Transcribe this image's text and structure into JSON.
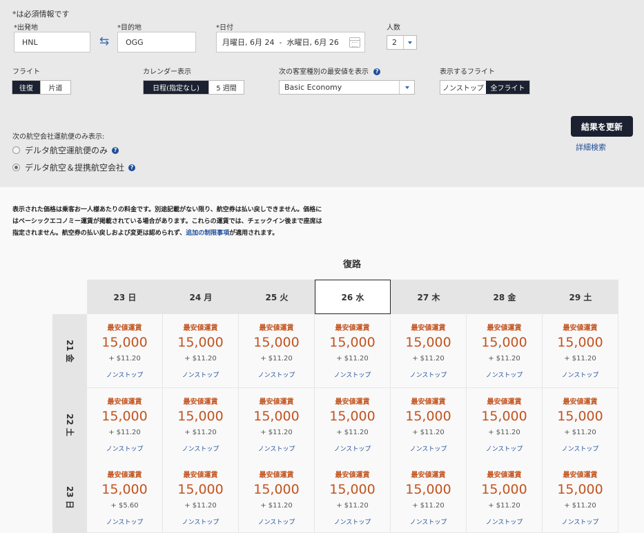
{
  "form": {
    "required_note": "*は必須情報です",
    "origin_label": "*出発地",
    "origin_value": "HNL",
    "destination_label": "*目的地",
    "destination_value": "OGG",
    "date_label": "*日付",
    "date_value": "月曜日, 6月 24  -  水曜日, 6月 26",
    "passengers_label": "人数",
    "passengers_value": "2"
  },
  "options": {
    "flight_label": "フライト",
    "flight_roundtrip": "往復",
    "flight_oneway": "片道",
    "calendar_label": "カレンダー表示",
    "calendar_flexible": "日程(指定なし)",
    "calendar_5weeks": "5 週間",
    "cabin_label": "次の客室種別の最安値を表示",
    "cabin_value": "Basic Economy",
    "display_label": "表示するフライト",
    "display_nonstop": "ノンストップ",
    "display_all": "全フライト"
  },
  "airline_filter": {
    "label": "次の航空会社運航便のみ表示:",
    "option_delta_only": "デルタ航空運航便のみ",
    "option_delta_partners": "デルタ航空＆提携航空会社"
  },
  "actions": {
    "update_label": "結果を更新",
    "advanced_search_label": "詳細検索"
  },
  "disclaimer": {
    "text": "表示された価格は乗客お一人様あたりの料金です。別途記載がない限り、航空券は払い戻しできません。価格にはベーシックエコノミー運賃が掲載されている場合があります。これらの運賃では、チェックイン後まで座席は指定されません。航空券の払い戻しおよび変更は認められず、",
    "link_text": "追加の制限事項",
    "suffix": "が適用されます。"
  },
  "grid": {
    "return_label": "復路",
    "return_days": [
      "23 日",
      "24 月",
      "25 火",
      "26 水",
      "27 木",
      "28 金",
      "29 土"
    ],
    "rows": [
      {
        "label": "21 金",
        "cells": [
          {
            "type": "最安値運賃",
            "price": "15,000",
            "tax": "+ $11.20",
            "stops": "ノンストップ"
          },
          {
            "type": "最安値運賃",
            "price": "15,000",
            "tax": "+ $11.20",
            "stops": "ノンストップ"
          },
          {
            "type": "最安値運賃",
            "price": "15,000",
            "tax": "+ $11.20",
            "stops": "ノンストップ"
          },
          {
            "type": "最安値運賃",
            "price": "15,000",
            "tax": "+ $11.20",
            "stops": "ノンストップ"
          },
          {
            "type": "最安値運賃",
            "price": "15,000",
            "tax": "+ $11.20",
            "stops": "ノンストップ"
          },
          {
            "type": "最安値運賃",
            "price": "15,000",
            "tax": "+ $11.20",
            "stops": "ノンストップ"
          },
          {
            "type": "最安値運賃",
            "price": "15,000",
            "tax": "+ $11.20",
            "stops": "ノンストップ"
          }
        ]
      },
      {
        "label": "22 土",
        "cells": [
          {
            "type": "最安値運賃",
            "price": "15,000",
            "tax": "+ $11.20",
            "stops": "ノンストップ"
          },
          {
            "type": "最安値運賃",
            "price": "15,000",
            "tax": "+ $11.20",
            "stops": "ノンストップ"
          },
          {
            "type": "最安値運賃",
            "price": "15,000",
            "tax": "+ $11.20",
            "stops": "ノンストップ"
          },
          {
            "type": "最安値運賃",
            "price": "15,000",
            "tax": "+ $11.20",
            "stops": "ノンストップ"
          },
          {
            "type": "最安値運賃",
            "price": "15,000",
            "tax": "+ $11.20",
            "stops": "ノンストップ"
          },
          {
            "type": "最安値運賃",
            "price": "15,000",
            "tax": "+ $11.20",
            "stops": "ノンストップ"
          },
          {
            "type": "最安値運賃",
            "price": "15,000",
            "tax": "+ $11.20",
            "stops": "ノンストップ"
          }
        ]
      },
      {
        "label": "23 日",
        "cells": [
          {
            "type": "最安値運賃",
            "price": "15,000",
            "tax": "+ $5.60",
            "stops": "ノンストップ"
          },
          {
            "type": "最安値運賃",
            "price": "15,000",
            "tax": "+ $11.20",
            "stops": "ノンストップ"
          },
          {
            "type": "最安値運賃",
            "price": "15,000",
            "tax": "+ $11.20",
            "stops": "ノンストップ"
          },
          {
            "type": "最安値運賃",
            "price": "15,000",
            "tax": "+ $11.20",
            "stops": "ノンストップ"
          },
          {
            "type": "最安値運賃",
            "price": "15,000",
            "tax": "+ $11.20",
            "stops": "ノンストップ"
          },
          {
            "type": "最安値運賃",
            "price": "15,000",
            "tax": "+ $11.20",
            "stops": "ノンストップ"
          },
          {
            "type": "最安値運賃",
            "price": "15,000",
            "tax": "+ $11.20",
            "stops": "ノンストップ"
          }
        ]
      }
    ]
  }
}
